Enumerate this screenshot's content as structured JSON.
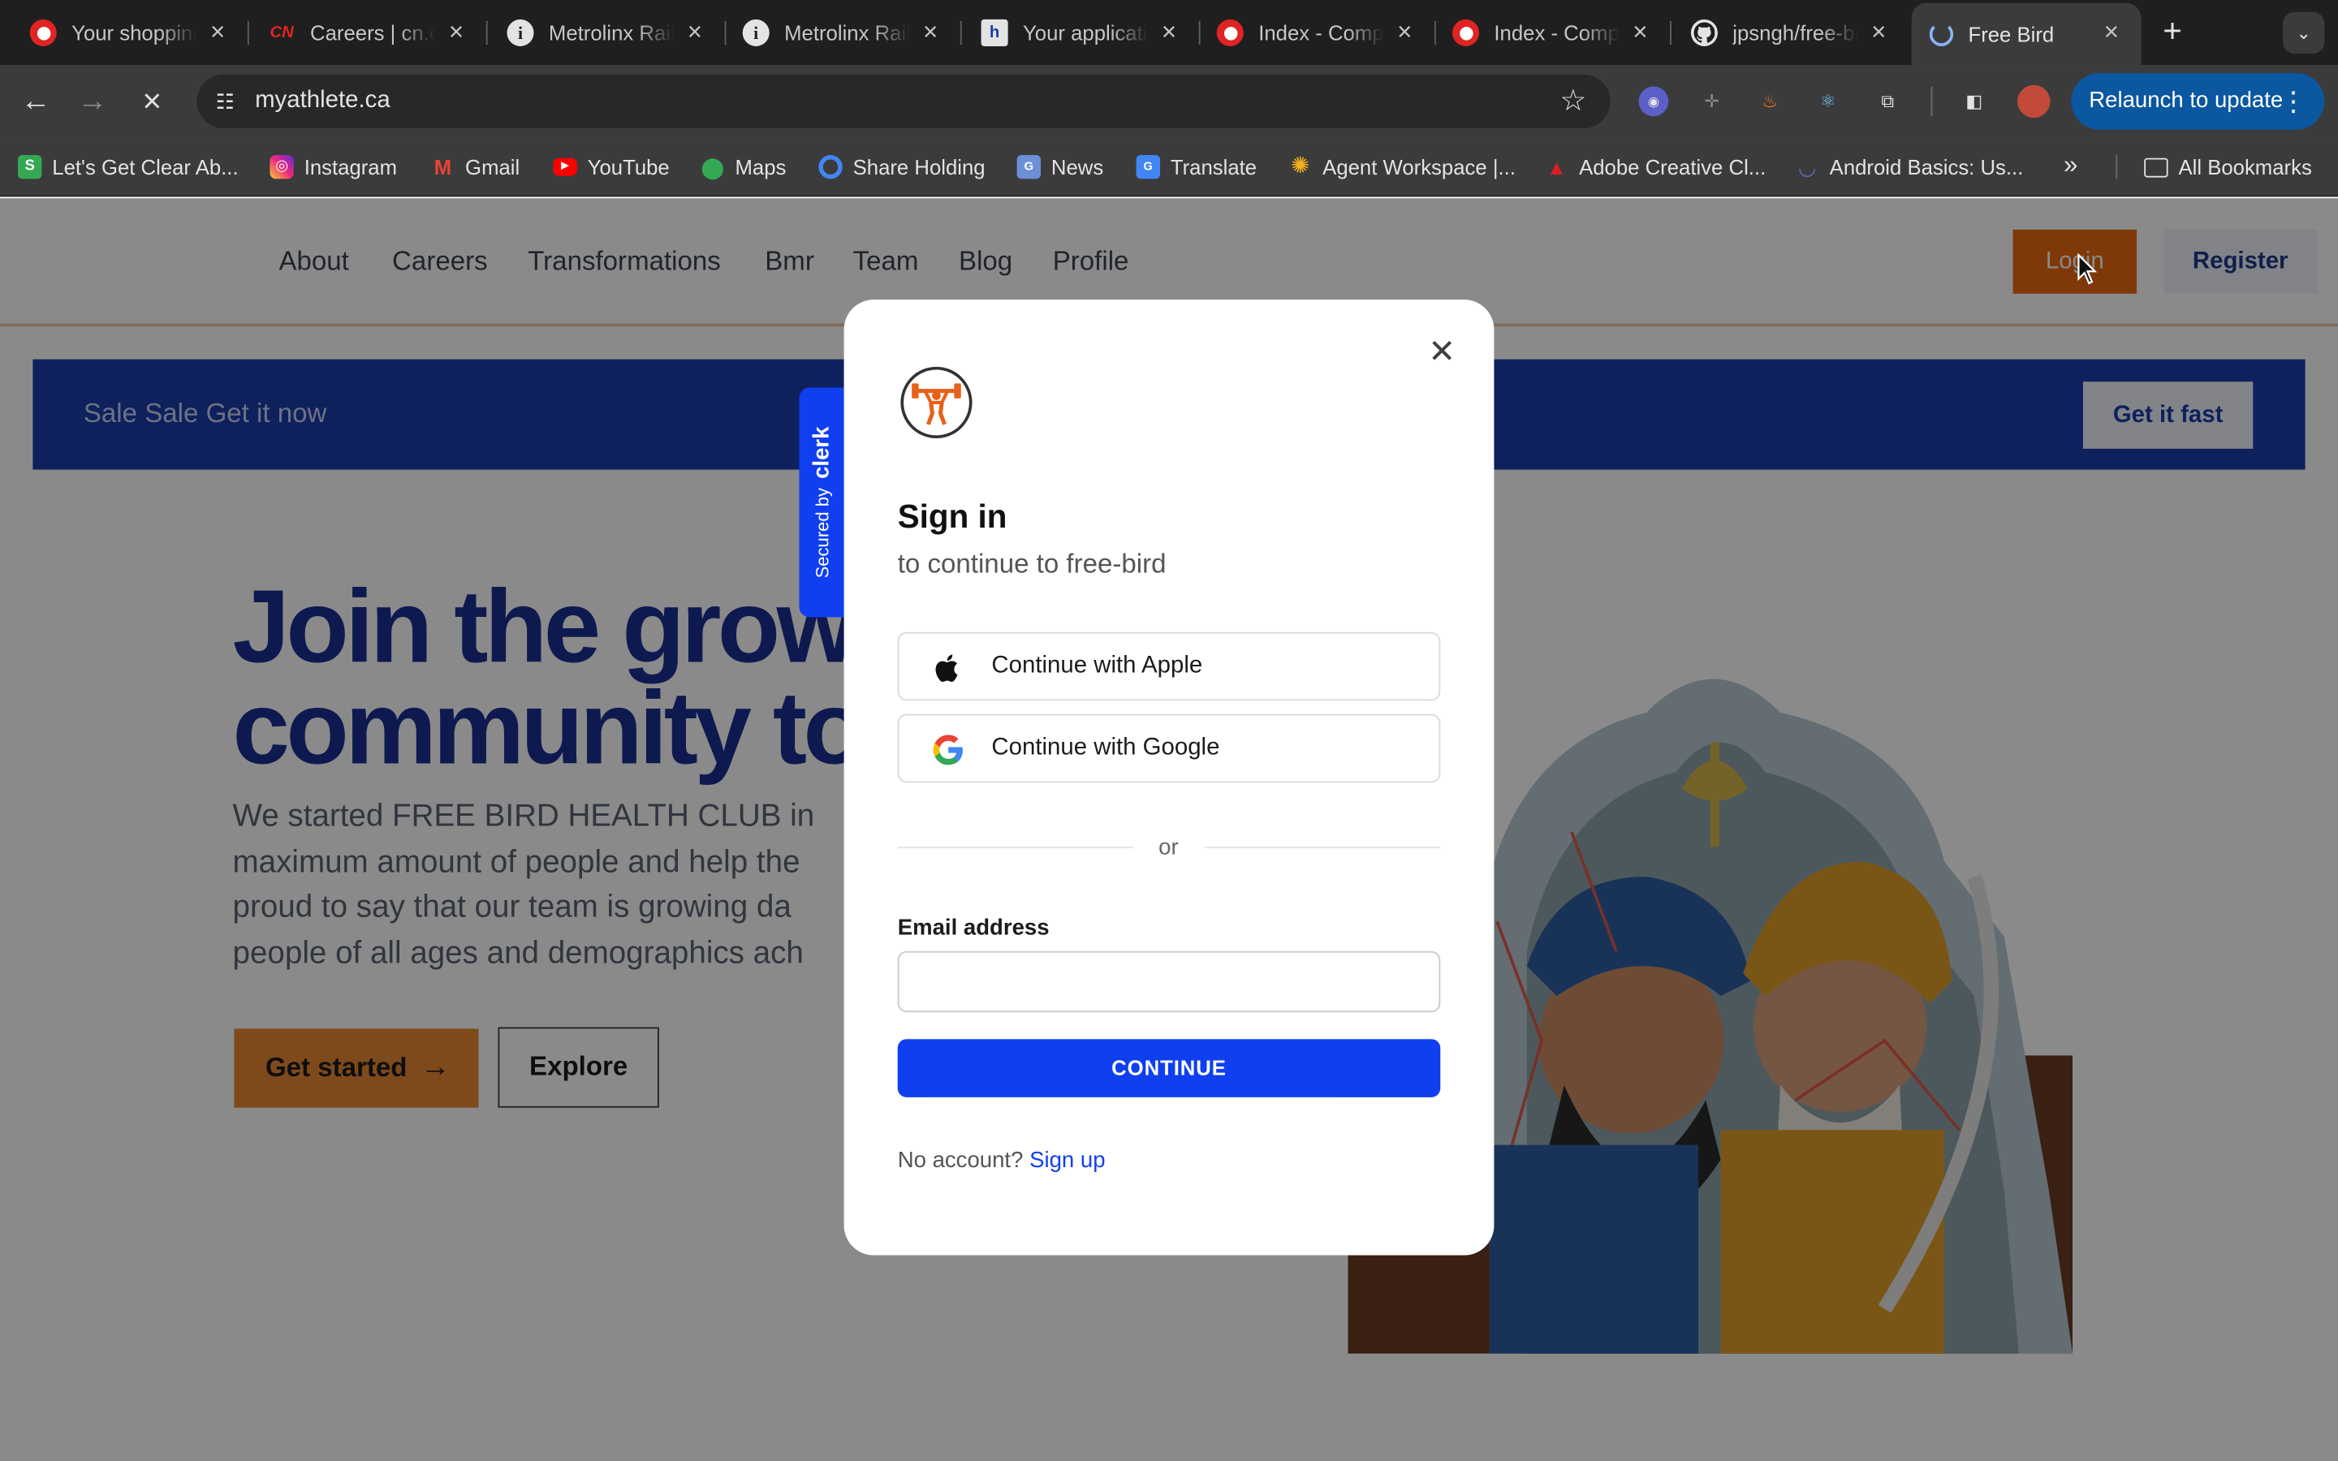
{
  "browser": {
    "tabs": [
      {
        "title": "Your shopping",
        "icon": "red-circle-icon",
        "active": false
      },
      {
        "title": "Careers | cn.ca",
        "icon": "cn-logo-icon",
        "active": false
      },
      {
        "title": "Metrolinx Rail",
        "icon": "info-icon",
        "active": false
      },
      {
        "title": "Metrolinx Rail",
        "icon": "info-icon",
        "active": false
      },
      {
        "title": "Your application",
        "icon": "document-icon",
        "active": false
      },
      {
        "title": "Index - Company",
        "icon": "red-circle-icon",
        "active": false
      },
      {
        "title": "Index - Company",
        "icon": "red-circle-icon",
        "active": false
      },
      {
        "title": "jpsngh/free-bird",
        "icon": "github-icon",
        "active": false
      },
      {
        "title": "Free Bird",
        "icon": "loading-icon",
        "active": true
      }
    ],
    "url": "myathlete.ca",
    "relaunch_label": "Relaunch to update",
    "bookmarks": [
      {
        "label": "Let's Get Clear Ab...",
        "icon": "s-letter-icon",
        "color": "#34a853"
      },
      {
        "label": "Instagram",
        "icon": "instagram-icon",
        "color": "#dd2a7b"
      },
      {
        "label": "Gmail",
        "icon": "gmail-icon",
        "color": "#ea4335"
      },
      {
        "label": "YouTube",
        "icon": "youtube-icon",
        "color": "#ff0000"
      },
      {
        "label": "Maps",
        "icon": "maps-pin-icon",
        "color": "#34a853"
      },
      {
        "label": "Share Holding",
        "icon": "share-icon",
        "color": "#4285f4"
      },
      {
        "label": "News",
        "icon": "news-icon",
        "color": "#4285f4"
      },
      {
        "label": "Translate",
        "icon": "translate-icon",
        "color": "#4285f4"
      },
      {
        "label": "Agent Workspace |...",
        "icon": "sun-icon",
        "color": "#f2b01e"
      },
      {
        "label": "Adobe Creative Cl...",
        "icon": "adobe-icon",
        "color": "#da1f26"
      },
      {
        "label": "Android Basics: Us...",
        "icon": "android-icon",
        "color": "#5c6bc0"
      }
    ],
    "all_bookmarks_label": "All Bookmarks"
  },
  "site": {
    "nav": [
      "About",
      "Careers",
      "Transformations",
      "Bmr",
      "Team",
      "Blog",
      "Profile"
    ],
    "login_label": "Login",
    "register_label": "Register",
    "banner_text": "Sale Sale Get it now",
    "banner_button": "Get it fast",
    "headline": [
      "Join the grow",
      "community to"
    ],
    "intro": [
      "We started FREE BIRD HEALTH CLUB in",
      "maximum amount of people and help the",
      "proud to say that our team is growing da",
      "people of all ages and demographics ach"
    ],
    "cta_primary": "Get started",
    "cta_secondary": "Explore",
    "accent": "#ea6a12",
    "brand_blue": "#1b3192"
  },
  "modal": {
    "secured_by": "Secured by",
    "secured_brand": "clerk",
    "title": "Sign in",
    "subtitle": "to continue to free-bird",
    "apple_label": "Continue with Apple",
    "google_label": "Continue with Google",
    "or_label": "or",
    "email_label": "Email address",
    "email_value": "",
    "continue_label": "CONTINUE",
    "no_account_text": "No account?",
    "sign_up_label": "Sign up",
    "primary_color": "#103ff0"
  }
}
